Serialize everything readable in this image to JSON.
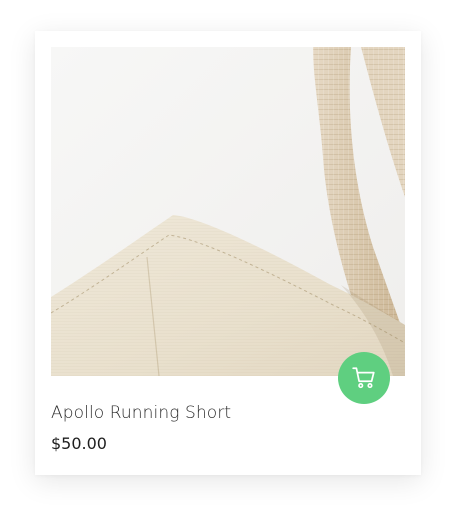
{
  "product": {
    "title": "Apollo Running Short",
    "price": "$50.00",
    "image_icon": "canvas-tote-bag-photo",
    "cart_icon": "cart-icon"
  },
  "colors": {
    "cart_button": "#5fcf80",
    "card_background": "#ffffff",
    "canvas": "#ece4d3",
    "strap": "#d8c7ae"
  }
}
